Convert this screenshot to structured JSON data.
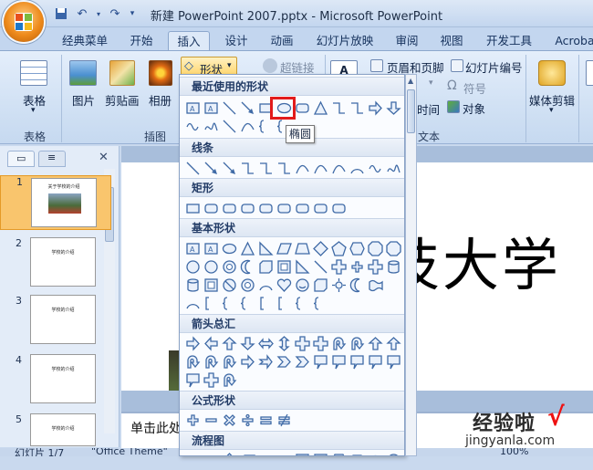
{
  "window": {
    "title": "新建 PowerPoint 2007.pptx - Microsoft PowerPoint"
  },
  "tabs": [
    "经典菜单",
    "开始",
    "插入",
    "设计",
    "动画",
    "幻灯片放映",
    "审阅",
    "视图",
    "开发工具",
    "Acroba"
  ],
  "active_tab": "插入",
  "ribbon": {
    "table_label": "表格",
    "table_group": "表格",
    "picture_label": "图片",
    "clipart_label": "剪贴画",
    "album_label": "相册",
    "illustrations_group": "插图",
    "shapes_label": "形状",
    "hyperlink_label": "超链接",
    "header_footer_label": "页眉和页脚",
    "slide_number_label": "幻灯片编号",
    "symbol_label": "符号",
    "datetime_label": "时间",
    "object_label": "对象",
    "text_group": "文本",
    "media_clip_label": "媒体剪辑"
  },
  "gallery": {
    "recent_header": "最近使用的形状",
    "lines_header": "线条",
    "rect_header": "矩形",
    "basic_header": "基本形状",
    "arrows_header": "箭头总汇",
    "equation_header": "公式形状",
    "flowchart_header": "流程图"
  },
  "tooltip": "椭圆",
  "slides": [
    {
      "num": "1",
      "title": "关于学校的介绍",
      "selected": true
    },
    {
      "num": "2",
      "title": "学校的介绍",
      "selected": false
    },
    {
      "num": "3",
      "title": "学校的介绍",
      "selected": false
    },
    {
      "num": "4",
      "title": "学校的介绍",
      "selected": false
    },
    {
      "num": "5",
      "title": "学校的介绍",
      "selected": false
    }
  ],
  "slide_text": "技大学",
  "notes_placeholder": "单击此处",
  "status": {
    "slide_count": "幻灯片 1/7",
    "theme": "\"Office Theme\"",
    "zoom": "100%"
  },
  "watermark": {
    "text": "经验啦",
    "check": "√",
    "url": "jingyanla.com"
  },
  "colors": {
    "highlight": "#e21b1b",
    "selected_thumb": "#f4a73a",
    "ribbon_bg": "#d1e1f4"
  }
}
